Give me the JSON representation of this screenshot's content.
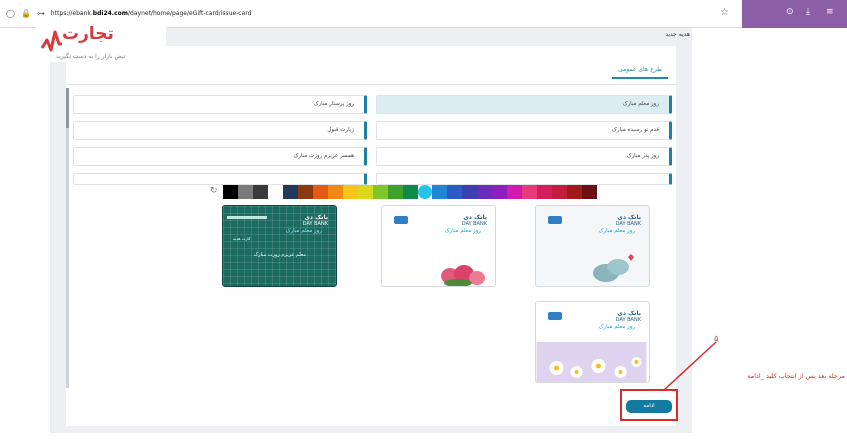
{
  "browser": {
    "url_prefix": "https://ebank.",
    "url_domain": "bdi24.com",
    "url_path": "/daynet/home/page/eGift-card/issue-card"
  },
  "logo": {
    "name": "تجارت",
    "tagline": "تبض بازار را به دست بگیرید"
  },
  "page": {
    "title": "هدیه جدید",
    "active_tab": "طرح های عمومی"
  },
  "gift_options": {
    "right": [
      "روز معلم مبارک",
      "قدم نو رسیده مبارک",
      "روز پدر مبارک"
    ],
    "left": [
      "روز پرستار مبارک",
      "زیارت قبول",
      "همسر عزیزم روزت مبارک"
    ]
  },
  "palette_colors": [
    "#6b1010",
    "#a01a1a",
    "#c21d3a",
    "#d41e5b",
    "#e83a7a",
    "#d11bb0",
    "#8e1fbf",
    "#6a2db8",
    "#3b3fb0",
    "#2a5cc4",
    "#1f86d4",
    "#27c2e8",
    "#0e8a4a",
    "#3fa02c",
    "#7dc72a",
    "#d7d91a",
    "#f5c51a",
    "#f08a14",
    "#e45a12",
    "#8b3a10",
    "#1f3a5a",
    "#ffffff",
    "#3a3a3a",
    "#7a7a7a",
    "#000000"
  ],
  "cards": {
    "brand_fa": "بانک دی",
    "brand_en": "DAY BANK",
    "title": "روز معلم مبارک",
    "green_handwriting": "معلم عزیزم روزت مبارک",
    "mini_label": "کارت هدیه"
  },
  "actions": {
    "continue": "ادامه"
  },
  "annotation": {
    "step": "۵",
    "text": "مرحله بعد پس از انتخاب کلید _ادامه"
  },
  "colors": {
    "accent": "#137ba0",
    "annotation_red": "#d42d2d"
  }
}
